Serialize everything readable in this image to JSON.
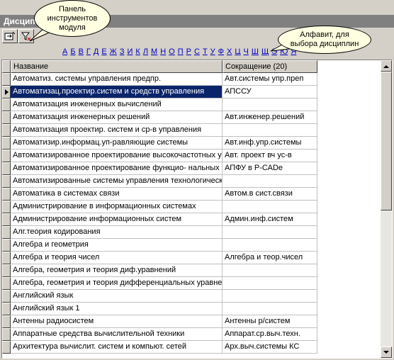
{
  "window": {
    "title": "Дисциплины"
  },
  "callouts": {
    "toolbar": "Панель инструментов модуля",
    "alphabet": "Алфавит, для выбора дисциплин"
  },
  "toolbar": {
    "buttons": [
      {
        "icon": "open-folder-icon"
      },
      {
        "icon": "filter-icon"
      }
    ]
  },
  "alphabet": [
    "А",
    "Б",
    "В",
    "Г",
    "Д",
    "Е",
    "Ж",
    "З",
    "И",
    "К",
    "Л",
    "М",
    "Н",
    "О",
    "П",
    "Р",
    "С",
    "Т",
    "У",
    "Ф",
    "Х",
    "Ц",
    "Ч",
    "Ш",
    "Щ",
    "Э",
    "Ю",
    "Я"
  ],
  "grid": {
    "columns": [
      "Название",
      "Сокращение (20)"
    ],
    "selected_row": 1,
    "rows": [
      [
        "Автоматиз. системы управления предпр.",
        "Авт.системы упр.преп"
      ],
      [
        "Автоматизац.проектир.систем и средств управления",
        "АПССУ"
      ],
      [
        "Автоматизация инженерных вычислений",
        ""
      ],
      [
        "Автоматизация инженерных решений",
        "Авт.инженер.решений"
      ],
      [
        "Автоматизация проектир. систем и ср-в управления",
        ""
      ],
      [
        "Автоматизир.информац.уп-равляющие системы",
        "Авт.инф.упр.системы"
      ],
      [
        "Автоматизированное проектирование высокочастотных устройств",
        "Авт. проект вч ус-в"
      ],
      [
        "Автоматизированное проектирование функцио- нальных узлов",
        "АПФУ в Р-САDе"
      ],
      [
        "Автоматизированные системы управления технологическими процессами",
        ""
      ],
      [
        "Автоматика в системах связи",
        "Автом.в сист.связи"
      ],
      [
        "Администрирование в информационных системах",
        ""
      ],
      [
        "Администрирование информационных систем",
        "Админ.инф.систем"
      ],
      [
        "Алг.теория кодирования",
        ""
      ],
      [
        "Алгебра и геометрия",
        ""
      ],
      [
        "Алгебра и теория чисел",
        "Алгебра и теор.чисел"
      ],
      [
        "Алгебра, геометрия и теория диф.уравнений",
        ""
      ],
      [
        "Алгебра, геометрия и теория дифференциальных уравнений",
        ""
      ],
      [
        "Английский язык",
        ""
      ],
      [
        "Английский язык 1",
        ""
      ],
      [
        "Антенны радиосистем",
        "Антенны р/систем"
      ],
      [
        "Аппаратные средства вычислительной техники",
        "Аппарат.ср.выч.техн."
      ],
      [
        "Архитектура вычислит. систем и компьют. сетей",
        "Арх.выч.системы КС"
      ]
    ]
  }
}
